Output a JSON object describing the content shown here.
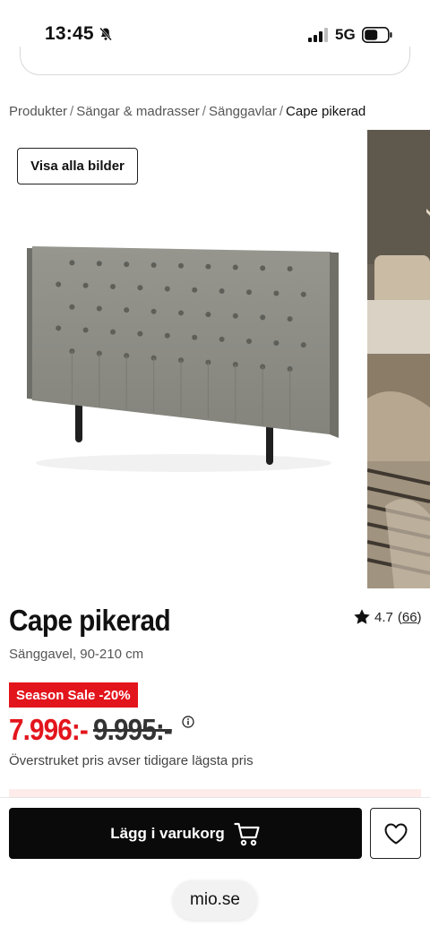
{
  "status_bar": {
    "time": "13:45",
    "network": "5G",
    "icons": [
      "bell-slash-icon",
      "signal-icon",
      "battery-icon"
    ]
  },
  "breadcrumb": {
    "items": [
      "Produkter",
      "Sängar & madrasser",
      "Sänggavlar"
    ],
    "current": "Cape pikerad",
    "separator": "/"
  },
  "gallery": {
    "view_all_label": "Visa alla bilder"
  },
  "product": {
    "title": "Cape pikerad",
    "subtitle": "Sänggavel, 90-210 cm",
    "rating": "4.7",
    "review_count": "66",
    "sale_badge": "Season Sale -20%",
    "price_now": "7.996:-",
    "price_old": "9.995:-",
    "price_note": "Överstruket pris avser tidigare lägsta pris"
  },
  "actions": {
    "add_to_cart_label": "Lägg i varukorg"
  },
  "browser": {
    "url": "mio.se"
  },
  "colors": {
    "sale_red": "#e3151c",
    "button_black": "#0a0a0a",
    "headboard_grey": "#8a8a84"
  }
}
